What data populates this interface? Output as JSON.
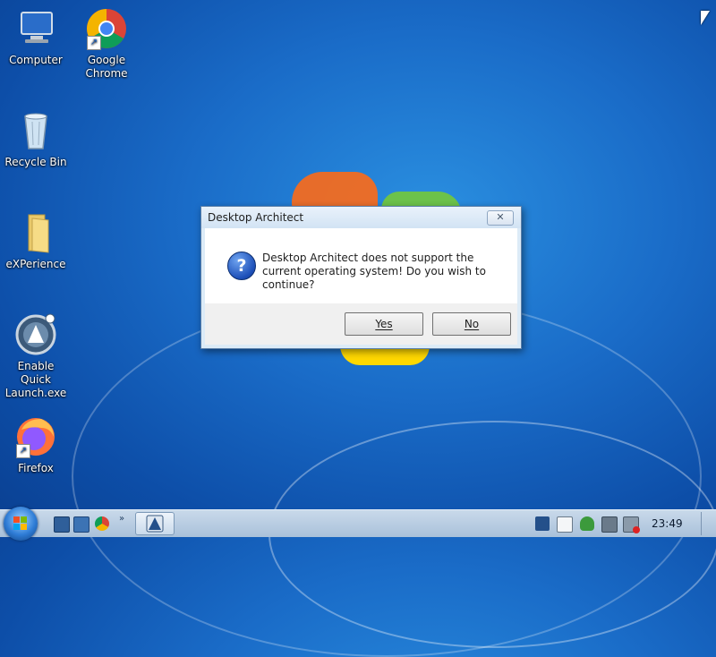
{
  "desktop": {
    "icons": [
      {
        "label_line1": "Computer",
        "label_line2": "",
        "icon": "computer-icon"
      },
      {
        "label_line1": "Google",
        "label_line2": "Chrome",
        "icon": "chrome-icon"
      },
      {
        "label_line1": "Recycle Bin",
        "label_line2": "",
        "icon": "recycle-bin-icon"
      },
      {
        "label_line1": "eXPerience",
        "label_line2": "",
        "icon": "folder-icon"
      },
      {
        "label_line1": "Enable Quick",
        "label_line2": "Launch.exe",
        "icon": "app-icon"
      },
      {
        "label_line1": "Firefox",
        "label_line2": "",
        "icon": "firefox-icon"
      }
    ]
  },
  "dialog": {
    "title": "Desktop Architect",
    "close_glyph": "✕",
    "message": "Desktop Architect does not support the current operating system! Do you wish to continue?",
    "question_glyph": "?",
    "yes_label": "Yes",
    "no_label": "No"
  },
  "taskbar": {
    "chevron": "»",
    "clock": "23:49",
    "quick_launch": [
      "show-desktop-icon",
      "switch-windows-icon",
      "chrome-icon"
    ],
    "tray": [
      "desktop-architect-tray-icon",
      "document-icon",
      "security-shield-icon",
      "network-icon",
      "volume-muted-icon"
    ]
  },
  "colors": {
    "accent": "#1a6cc8",
    "taskbar": "#b9cde2",
    "dialog_frame": "#dcebf7"
  }
}
